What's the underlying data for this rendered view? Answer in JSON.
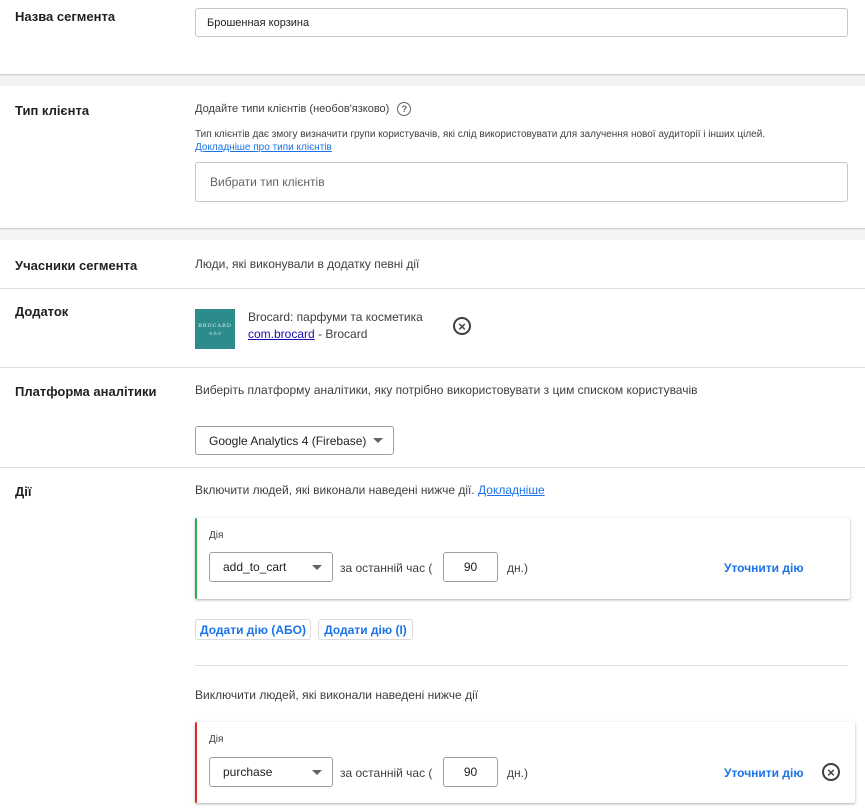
{
  "segment_name": {
    "label": "Назва сегмента",
    "value": "Брошенная корзина"
  },
  "customer_type": {
    "label": "Тип клієнта",
    "heading": "Додайте типи клієнтів (необов'язково)",
    "description": "Тип клієнтів дає змогу визначити групи користувачів, які слід використовувати для залучення нової аудиторії і інших цілей.",
    "learn_more": "Докладніше про типи клієнтів",
    "placeholder": "Вибрати тип клієнтів"
  },
  "members": {
    "label": "Учасники сегмента",
    "value": "Люди, які виконували в додатку певні дії"
  },
  "app": {
    "label": "Додаток",
    "name": "Brocard: парфуми та косметика",
    "package": "com.brocard",
    "developer": " - Brocard",
    "logo_text": "BROCARD",
    "logo_subtext": "ᐊ ⁂ ᐅ"
  },
  "analytics": {
    "label": "Платформа аналітики",
    "description": "Виберіть платформу аналітики, яку потрібно використовувати з цим списком користувачів",
    "selected": "Google Analytics 4 (Firebase)"
  },
  "actions": {
    "label": "Дії",
    "include_text": "Включити людей, які виконали наведені нижче дії.",
    "include_link": "Докладніше",
    "include_card": {
      "title": "Дія",
      "event": "add_to_cart",
      "period_prefix": "за останній час (",
      "days": "90",
      "period_suffix": "дн.)",
      "refine": "Уточнити дію"
    },
    "add_or": "Додати дію (АБО)",
    "add_and": "Додати дію (І)",
    "exclude_text": "Виключити людей, які виконали наведені нижче дії",
    "exclude_card": {
      "title": "Дія",
      "event": "purchase",
      "period_prefix": "за останній час (",
      "days": "90",
      "period_suffix": "дн.)",
      "refine": "Уточнити дію"
    }
  },
  "colors": {
    "link": "#1a73e8",
    "include_accent": "#34a853",
    "exclude_accent": "#d93025"
  }
}
